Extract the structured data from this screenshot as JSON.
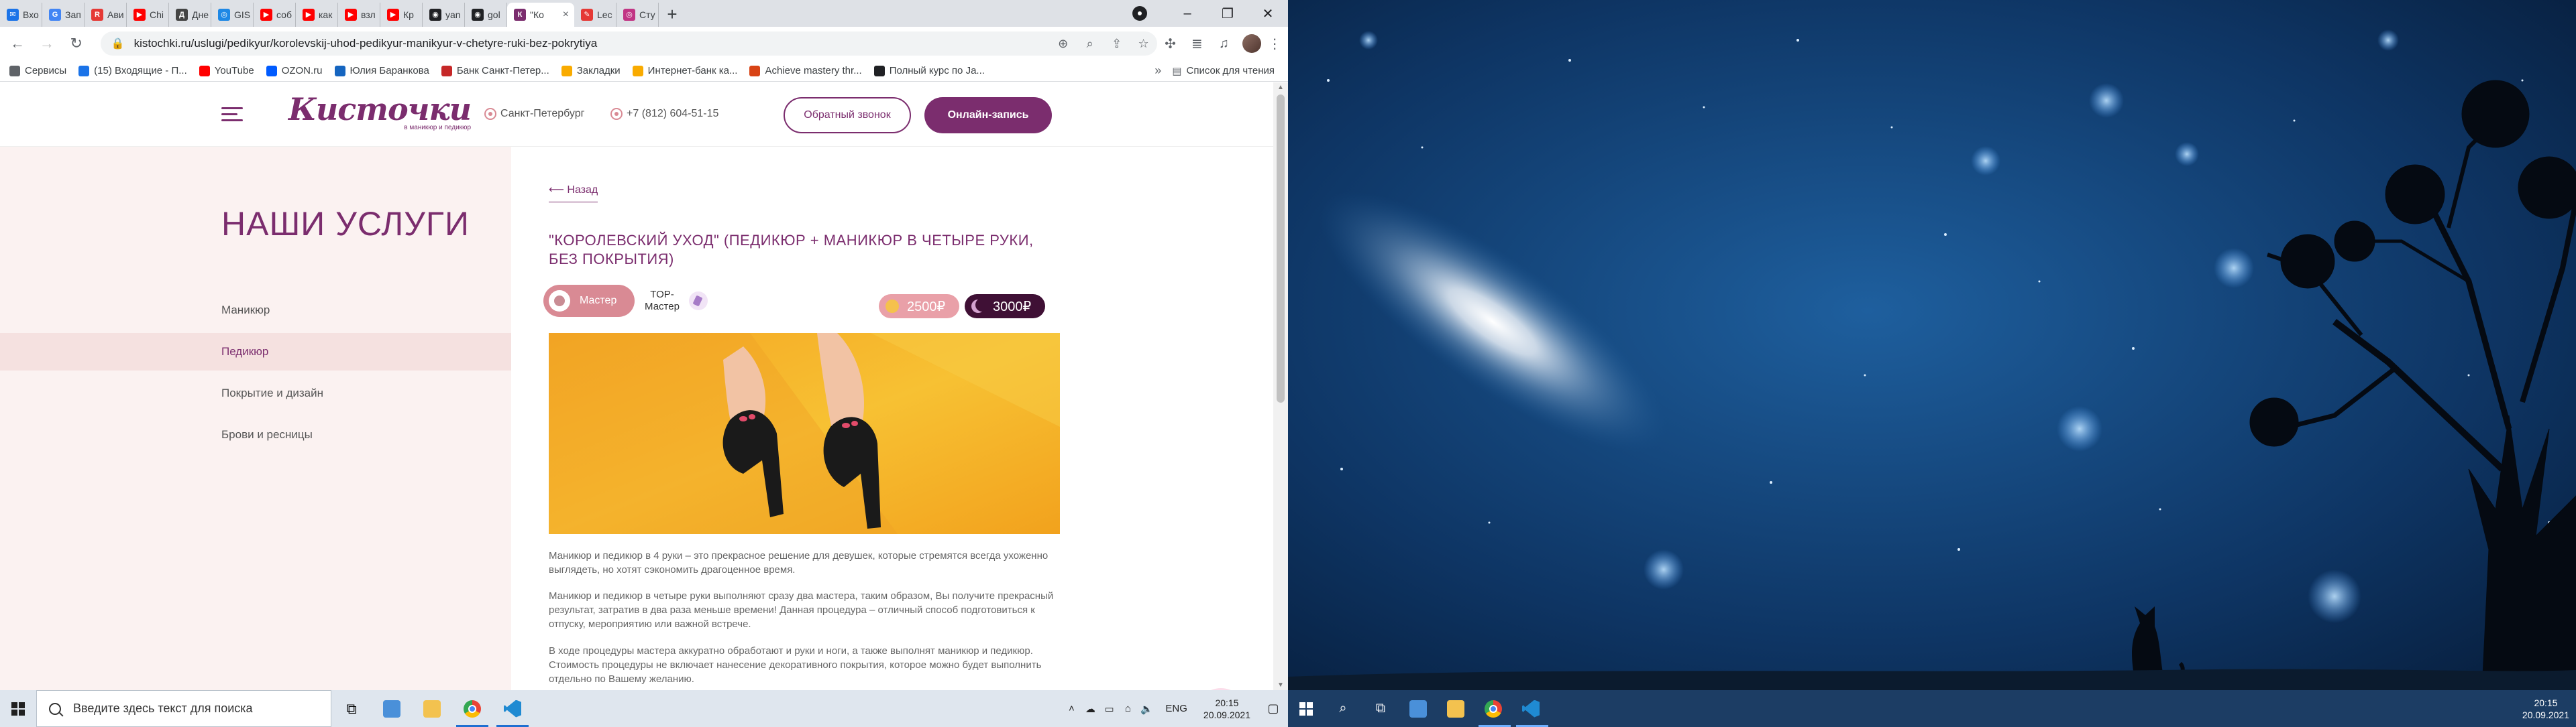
{
  "browser": {
    "tabs": [
      {
        "label": "Вхо",
        "fav_color": "#1a73e8",
        "fav_glyph": "✉"
      },
      {
        "label": "Зап",
        "fav_color": "#4285f4",
        "fav_glyph": "G"
      },
      {
        "label": "Ави",
        "fav_color": "#e53935",
        "fav_glyph": "R"
      },
      {
        "label": "Chi",
        "fav_color": "#ff0000",
        "fav_glyph": "▶"
      },
      {
        "label": "Дне",
        "fav_color": "#444444",
        "fav_glyph": "Д"
      },
      {
        "label": "GIS",
        "fav_color": "#1e88e5",
        "fav_glyph": "◎"
      },
      {
        "label": "соб",
        "fav_color": "#ff0000",
        "fav_glyph": "▶"
      },
      {
        "label": "как",
        "fav_color": "#ff0000",
        "fav_glyph": "▶"
      },
      {
        "label": "взл",
        "fav_color": "#ff0000",
        "fav_glyph": "▶"
      },
      {
        "label": "Кр",
        "fav_color": "#ff0000",
        "fav_glyph": "▶"
      },
      {
        "label": "yan",
        "fav_color": "#202124",
        "fav_glyph": "◉"
      },
      {
        "label": "gol",
        "fav_color": "#202124",
        "fav_glyph": "◉"
      },
      {
        "label": "\"Ко",
        "fav_color": "#7b2d6e",
        "fav_glyph": "К",
        "active": true
      },
      {
        "label": "Lec",
        "fav_color": "#e53935",
        "fav_glyph": "✎"
      },
      {
        "label": "Сту",
        "fav_color": "#c13584",
        "fav_glyph": "◎"
      }
    ],
    "new_tab_glyph": "+",
    "url": "kistochki.ru/uslugi/pedikyur/korolevskij-uhod-pedikyur-manikyur-v-chetyre-ruki-bez-pokrytiya",
    "bookmarks": [
      {
        "label": "Сервисы",
        "color": "#5f6368"
      },
      {
        "label": "(15) Входящие - П...",
        "color": "#1a73e8"
      },
      {
        "label": "YouTube",
        "color": "#ff0000"
      },
      {
        "label": "OZON.ru",
        "color": "#005bff"
      },
      {
        "label": "Юлия Баранкова",
        "color": "#1565c0"
      },
      {
        "label": "Банк Санкт-Петер...",
        "color": "#c62828"
      },
      {
        "label": "Закладки",
        "color": "#f9ab00"
      },
      {
        "label": "Интернет-банк ка...",
        "color": "#f9ab00"
      },
      {
        "label": "Achieve mastery thr...",
        "color": "#d84315"
      },
      {
        "label": "Полный курс по Ja...",
        "color": "#202124"
      }
    ],
    "bookmarks_more": "»",
    "reading_list": "Список для чтения"
  },
  "site": {
    "logo_text": "Кисточки",
    "logo_sub": "в маникюр и педикюр",
    "city": "Санкт-Петербург",
    "phone": "+7 (812) 604-51-15",
    "callback_label": "Обратный звонок",
    "booking_label": "Онлайн-запись",
    "services_title": "НАШИ УСЛУГИ",
    "services": [
      {
        "label": "Маникюр",
        "active": false
      },
      {
        "label": "Педикюр",
        "active": true
      },
      {
        "label": "Покрытие и дизайн",
        "active": false
      },
      {
        "label": "Брови и ресницы",
        "active": false
      }
    ],
    "back_label": "⟵ Назад",
    "service_title": "\"КОРОЛЕВСКИЙ УХОД\" (ПЕДИКЮР + МАНИКЮР В ЧЕТЫРЕ РУКИ, БЕЗ ПОКРЫТИЯ)",
    "master_tab": "Мастер",
    "top_master_tab": "TOP-Мастер",
    "price_day": "2500₽",
    "price_night": "3000₽",
    "paragraphs": [
      "Маникюр и педикюр в 4 руки – это прекрасное решение для девушек, которые стремятся всегда ухоженно выглядеть, но хотят сэкономить драгоценное время.",
      "Маникюр и педикюр в четыре руки выполняют сразу два мастера, таким образом, Вы получите прекрасный результат, затратив в два раза меньше времени! Данная процедура – отличный способ подготовиться к отпуску, мероприятию или важной встрече.",
      "В ходе процедуры мастера аккуратно обработают и руки и ноги, а также выполнят маникюр и педикюр. Стоимость процедуры не включает нанесение декоративного покрытия, которое можно будет выполнить отдельно по Вашему желанию."
    ]
  },
  "taskbar": {
    "search_placeholder": "Введите здесь текст для поиска",
    "lang": "ENG",
    "time": "20:15",
    "date": "20.09.2021"
  },
  "colors": {
    "brand": "#7b2d6e",
    "accent_pink": "#d98a94",
    "chat": "#e31b73"
  }
}
